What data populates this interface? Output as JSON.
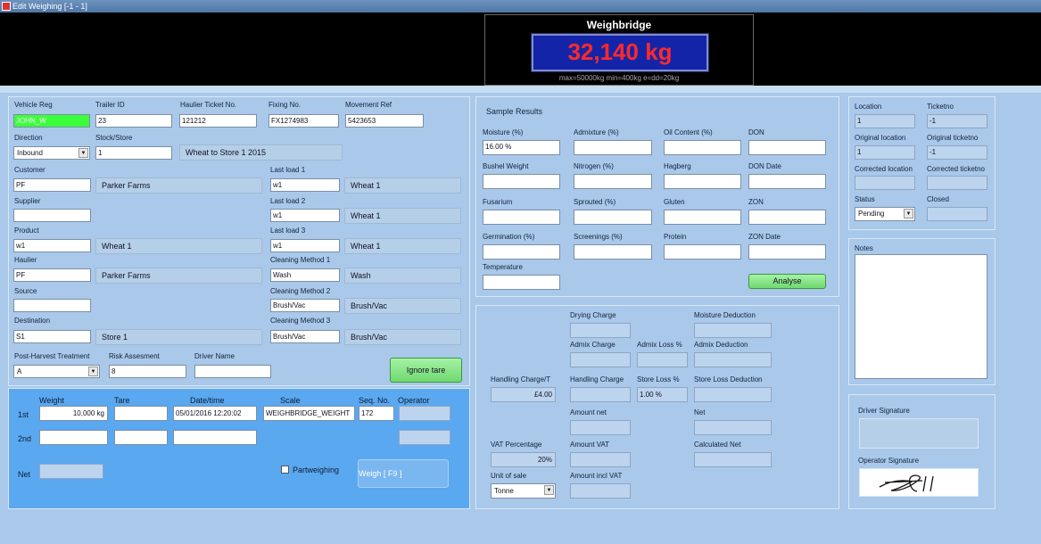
{
  "window": {
    "title": "Edit Weighing [-1 - 1]"
  },
  "weighbridge": {
    "title": "Weighbridge",
    "value": "32,140 kg",
    "spec": "max=50000kg min=400kg e=dd=20kg"
  },
  "vehicle": {
    "vehicle_reg_label": "Vehicle Reg",
    "vehicle_reg": "JOHN_W",
    "trailer_id_label": "Trailer ID",
    "trailer_id": "23",
    "haulier_ticket_label": "Haulier Ticket No.",
    "haulier_ticket": "121212",
    "fixing_no_label": "Fixing No.",
    "fixing_no": "FX1274983",
    "movement_ref_label": "Movement Ref",
    "movement_ref": "5423653",
    "direction_label": "Direction",
    "direction": "Inbound",
    "stock_store_label": "Stock/Store",
    "stock_store": "1",
    "stock_store_desc": "Wheat to Store 1 2015",
    "customer_label": "Customer",
    "customer": "PF",
    "customer_desc": "Parker Farms",
    "supplier_label": "Supplier",
    "supplier": "",
    "product_label": "Product",
    "product": "w1",
    "product_desc": "Wheat 1",
    "haulier_label": "Haulier",
    "haulier": "PF",
    "haulier_desc": "Parker Farms",
    "source_label": "Source",
    "source": "",
    "destination_label": "Destination",
    "destination": "S1",
    "destination_desc": "Store 1",
    "last_load1_label": "Last load 1",
    "last_load1": "w1",
    "last_load1_desc": "Wheat 1",
    "last_load2_label": "Last load 2",
    "last_load2": "w1",
    "last_load2_desc": "Wheat 1",
    "last_load3_label": "Last load 3",
    "last_load3": "w1",
    "last_load3_desc": "Wheat 1",
    "clean1_label": "Cleaning Method 1",
    "clean1": "Wash",
    "clean1_desc": "Wash",
    "clean2_label": "Cleaning Method 2",
    "clean2": "Brush/Vac",
    "clean2_desc": "Brush/Vac",
    "clean3_label": "Cleaning Method 3",
    "clean3": "Brush/Vac",
    "clean3_desc": "Brush/Vac",
    "pht_label": "Post-Harvest Treatment",
    "pht": "A",
    "risk_label": "Risk Assesment",
    "risk": "8",
    "driver_label": "Driver Name",
    "driver": "",
    "ignore_tare": "Ignore tare"
  },
  "weighing": {
    "h_weight": "Weight",
    "h_tare": "Tare",
    "h_datetime": "Date/time",
    "h_scale": "Scale",
    "h_seq": "Seq. No.",
    "h_operator": "Operator",
    "row1_label": "1st",
    "row1_weight": "10,000 kg",
    "row1_tare": "",
    "row1_datetime": "05/01/2016 12:20:02",
    "row1_scale": "WEIGHBRIDGE_WEIGHT",
    "row1_seq": "172",
    "row1_operator": "",
    "row2_label": "2nd",
    "net_label": "Net",
    "partweighing": "Partweighing",
    "weigh_button": "Weigh  [ F9 ]"
  },
  "samples": {
    "title": "Sample Results",
    "moisture_label": "Moisture (%)",
    "moisture": "16.00 %",
    "admixture_label": "Admixture (%)",
    "oil_label": "Oil Content (%)",
    "don_label": "DON",
    "bushel_label": "Bushel Weight",
    "nitrogen_label": "Nitrogen (%)",
    "hagberg_label": "Hagberg",
    "don_date_label": "DON Date",
    "fusarium_label": "Fusarium",
    "sprouted_label": "Sprouted (%)",
    "gluten_label": "Gluten",
    "zon_label": "ZON",
    "germination_label": "Germination (%)",
    "screenings_label": "Screenings (%)",
    "protein_label": "Protein",
    "zon_date_label": "ZON Date",
    "temperature_label": "Temperature",
    "analyse_button": "Analyse"
  },
  "charges": {
    "drying_label": "Drying Charge",
    "moisture_ded_label": "Moisture Deduction",
    "admix_charge_label": "Admix Charge",
    "admix_loss_label": "Admix Loss %",
    "admix_ded_label": "Admix Deduction",
    "handling_t_label": "Handling Charge/T",
    "handling_t": "£4.00",
    "handling_label": "Handling Charge",
    "store_loss_label": "Store Loss %",
    "store_loss": "1.00 %",
    "store_loss_ded_label": "Store Loss Deduction",
    "amount_net_label": "Amount net",
    "net_label": "Net",
    "vat_pct_label": "VAT Percentage",
    "vat_pct": "20%",
    "amount_vat_label": "Amount VAT",
    "calc_net_label": "Calculated Net",
    "unit_label": "Unit of sale",
    "unit": "Tonne",
    "amount_incl_label": "Amount incl VAT"
  },
  "location": {
    "location_label": "Location",
    "location": "1",
    "ticketno_label": "Ticketno",
    "ticketno": "-1",
    "orig_loc_label": "Original location",
    "orig_loc": "1",
    "orig_ticket_label": "Original ticketno",
    "orig_ticket": "-1",
    "corr_loc_label": "Corrected location",
    "corr_ticket_label": "Corrected ticketno",
    "status_label": "Status",
    "status": "Pending",
    "closed_label": "Closed",
    "notes_label": "Notes",
    "driver_sig_label": "Driver Signature",
    "operator_sig_label": "Operator Signature"
  }
}
